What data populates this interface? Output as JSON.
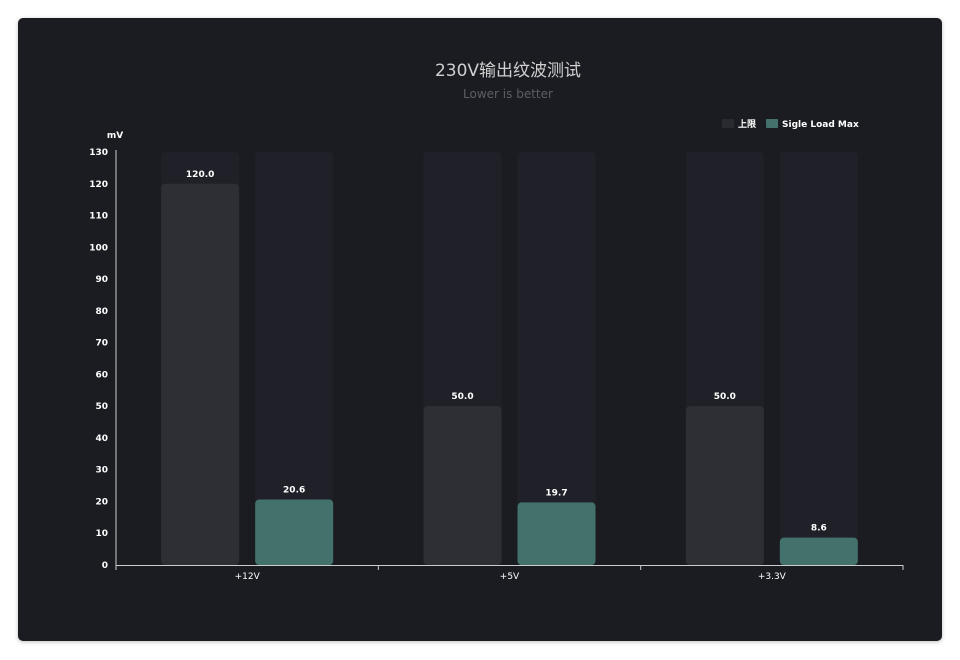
{
  "chart_data": {
    "type": "bar",
    "title": "230V输出纹波测试",
    "subtitle": "Lower is better",
    "ylabel": "mV",
    "xlabel": "",
    "categories": [
      "+12V",
      "+5V",
      "+3.3V"
    ],
    "series": [
      {
        "name": "上限",
        "values": [
          120.0,
          50.0,
          50.0
        ],
        "labels": [
          "120.0",
          "50.0",
          "50.0"
        ],
        "color": "#2e2f35"
      },
      {
        "name": "Sigle Load Max",
        "values": [
          20.6,
          19.7,
          8.6
        ],
        "labels": [
          "20.6",
          "19.7",
          "8.6"
        ],
        "color": "#43716b"
      }
    ],
    "ylim": [
      0,
      130
    ],
    "yticks": [
      "0",
      "10",
      "20",
      "30",
      "40",
      "50",
      "60",
      "70",
      "80",
      "90",
      "100",
      "110",
      "120",
      "130"
    ],
    "grid": false,
    "legend": "top-right",
    "colors": {
      "background": "#1b1c22",
      "bar_track": "#202128",
      "text": "#ffffff",
      "title": "#d0d0d0",
      "subtitle": "#5c5e66",
      "axis": "#cccccc"
    }
  }
}
